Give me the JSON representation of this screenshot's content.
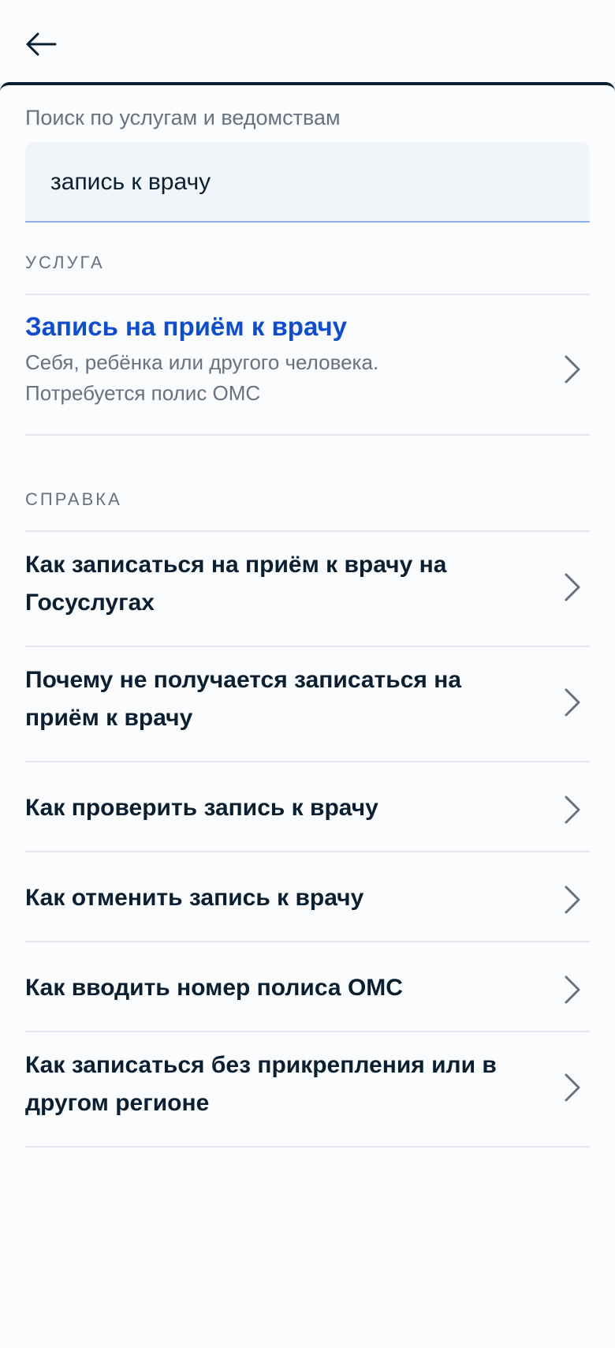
{
  "header": {
    "back_icon": "arrow-left-icon"
  },
  "search": {
    "label": "Поиск по услугам и ведомствам",
    "value": "запись к врачу"
  },
  "service_section": {
    "label": "УСЛУГА",
    "item": {
      "title": "Запись на приём к врачу",
      "desc_line1": "Себя, ребёнка или другого человека.",
      "desc_line2": "Потребуется полис ОМС"
    }
  },
  "help_section": {
    "label": "СПРАВКА",
    "items": [
      {
        "title": "Как записаться на приём к врачу на Госуслугах"
      },
      {
        "title": "Почему не получается записаться на приём к врачу"
      },
      {
        "title": "Как проверить запись к врачу"
      },
      {
        "title": "Как отменить запись к врачу"
      },
      {
        "title": "Как вводить номер полиса ОМС"
      },
      {
        "title": "Как записаться без прикрепления или в другом регионе"
      }
    ]
  },
  "colors": {
    "accent": "#0d4cd3",
    "text": "#0b1f33",
    "muted": "#66727f",
    "background": "#fbfcfe"
  }
}
